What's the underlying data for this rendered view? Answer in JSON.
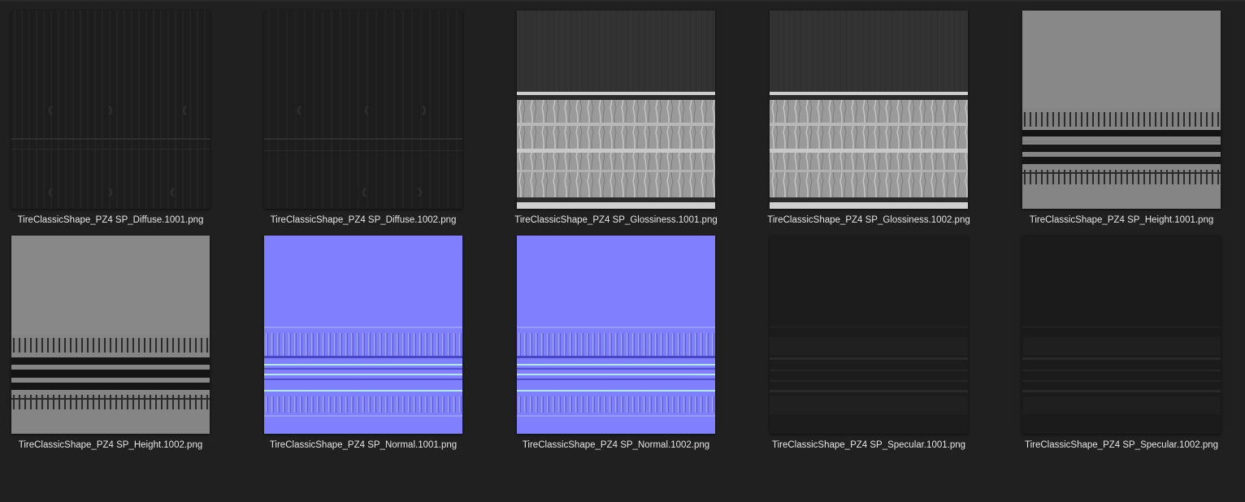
{
  "files": [
    {
      "name": "TireClassicShape_PZ4 SP_Diffuse.1001.png",
      "kind": "diffuse-a"
    },
    {
      "name": "TireClassicShape_PZ4 SP_Diffuse.1002.png",
      "kind": "diffuse-b"
    },
    {
      "name": "TireClassicShape_PZ4 SP_Glossiness.1001.png",
      "kind": "gloss"
    },
    {
      "name": "TireClassicShape_PZ4 SP_Glossiness.1002.png",
      "kind": "gloss"
    },
    {
      "name": "TireClassicShape_PZ4 SP_Height.1001.png",
      "kind": "height-a"
    },
    {
      "name": "TireClassicShape_PZ4 SP_Height.1002.png",
      "kind": "height-b"
    },
    {
      "name": "TireClassicShape_PZ4 SP_Normal.1001.png",
      "kind": "normal"
    },
    {
      "name": "TireClassicShape_PZ4 SP_Normal.1002.png",
      "kind": "normal"
    },
    {
      "name": "TireClassicShape_PZ4 SP_Specular.1001.png",
      "kind": "specular"
    },
    {
      "name": "TireClassicShape_PZ4 SP_Specular.1002.png",
      "kind": "specular"
    }
  ],
  "colors": {
    "background": "#202020",
    "label_text": "#e6e6e6",
    "normal_map_blue": "#8080ff"
  }
}
